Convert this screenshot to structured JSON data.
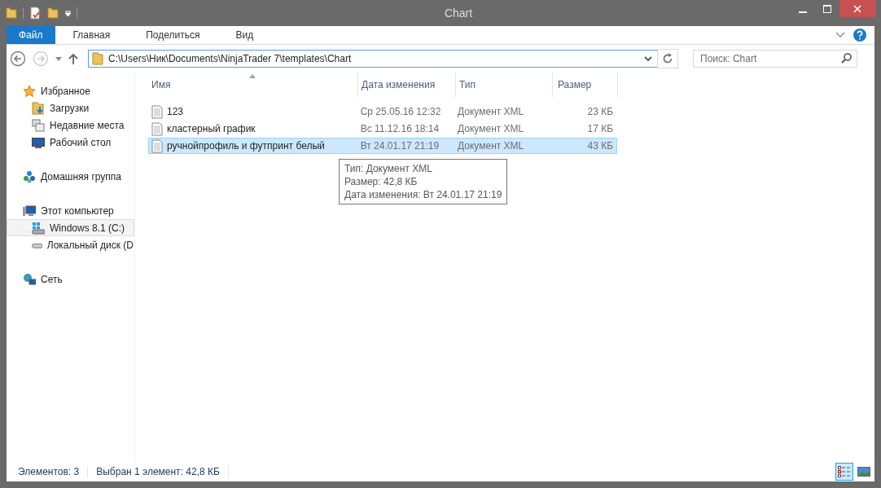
{
  "window": {
    "title": "Chart"
  },
  "ribbon_tabs": [
    {
      "label": "Файл",
      "selected": true,
      "kind": "file"
    },
    {
      "label": "Главная",
      "selected": false,
      "kind": "tab"
    },
    {
      "label": "Поделиться",
      "selected": false,
      "kind": "tab"
    },
    {
      "label": "Вид",
      "selected": false,
      "kind": "tab"
    }
  ],
  "address": {
    "value": "C:\\Users\\Ник\\Documents\\NinjaTrader 7\\templates\\Chart"
  },
  "search": {
    "placeholder": "Поиск: Chart"
  },
  "sidebar": {
    "items": [
      {
        "label": "Избранное",
        "kind": "star",
        "selected": false,
        "children": [
          {
            "label": "Загрузки",
            "kind": "downloads",
            "selected": false
          },
          {
            "label": "Недавние места",
            "kind": "recent",
            "selected": false
          },
          {
            "label": "Рабочий стол",
            "kind": "desktop",
            "selected": false
          }
        ]
      },
      {
        "label": "Домашняя группа",
        "kind": "homegroup",
        "selected": false
      },
      {
        "label": "Этот компьютер",
        "kind": "computer",
        "selected": false,
        "children": [
          {
            "label": "Windows 8.1 (C:)",
            "kind": "windrive",
            "selected": true
          },
          {
            "label": "Локальный диск (D",
            "kind": "drive",
            "selected": false
          }
        ]
      },
      {
        "label": "Сеть",
        "kind": "network",
        "selected": false
      }
    ]
  },
  "table": {
    "columns": [
      "Имя",
      "Дата изменения",
      "Тип",
      "Размер"
    ],
    "rows": [
      {
        "name": "123",
        "date": "Ср 25.05.16 12:32",
        "type": "Документ XML",
        "size": "23 КБ",
        "selected": false
      },
      {
        "name": "кластерный  график",
        "date": "Вс 11.12.16 18:14",
        "type": "Документ XML",
        "size": "17 КБ",
        "selected": false
      },
      {
        "name": "ручнойпрофиль и футпринт белый",
        "date": "Вт 24.01.17 21:19",
        "type": "Документ XML",
        "size": "43 КБ",
        "selected": true
      }
    ]
  },
  "tooltip": {
    "lines": [
      "Тип: Документ XML",
      "Размер: 42,8 КБ",
      "Дата изменения: Вт 24.01.17 21:19"
    ]
  },
  "status_bar": {
    "items": [
      "Элементов: 3",
      "Выбран 1 элемент: 42,8 КБ"
    ],
    "views": [
      {
        "kind": "details",
        "selected": true
      },
      {
        "kind": "large",
        "selected": false
      }
    ]
  }
}
